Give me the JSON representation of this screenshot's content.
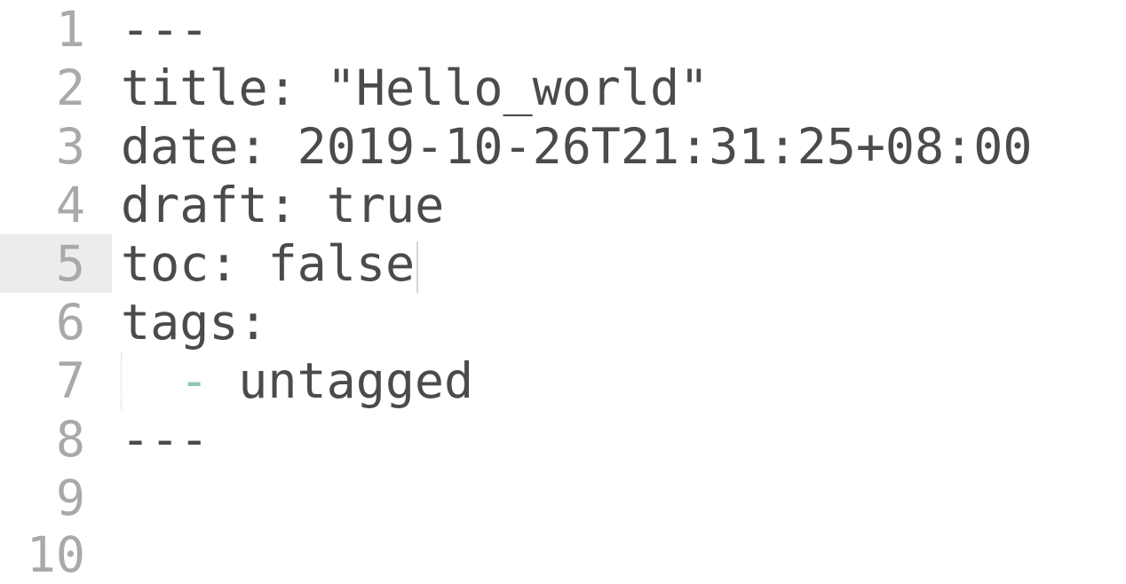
{
  "editor": {
    "active_line": 5,
    "lines": [
      {
        "number": "1",
        "text": "---"
      },
      {
        "number": "2",
        "text": "title: \"Hello_world\""
      },
      {
        "number": "3",
        "text": "date: 2019-10-26T21:31:25+08:00"
      },
      {
        "number": "4",
        "text": "draft: true"
      },
      {
        "number": "5",
        "text": "toc: false"
      },
      {
        "number": "6",
        "text": "tags:"
      },
      {
        "number": "7",
        "dash": "-",
        "text": "untagged"
      },
      {
        "number": "8",
        "text": "---"
      },
      {
        "number": "9",
        "text": ""
      },
      {
        "number": "10",
        "text": ""
      }
    ]
  },
  "colors": {
    "text": "#4b4b4b",
    "gutter_text": "#a9a9a9",
    "active_gutter_bg": "#ececec",
    "list_dash": "#8fc4bf"
  }
}
